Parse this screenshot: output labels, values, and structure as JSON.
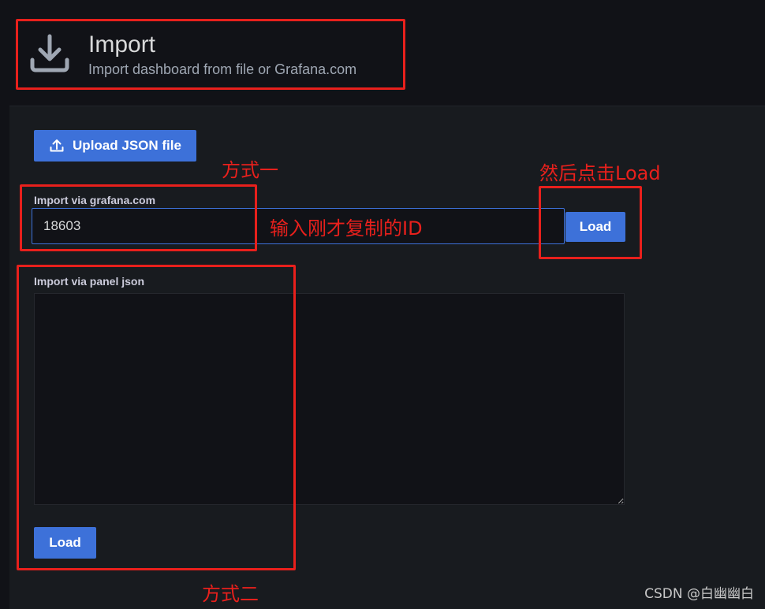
{
  "header": {
    "icon": "download-icon",
    "title": "Import",
    "subtitle": "Import dashboard from file or Grafana.com"
  },
  "upload": {
    "icon": "upload-icon",
    "label": "Upload JSON file"
  },
  "grafana_import": {
    "label": "Import via grafana.com",
    "value": "18603",
    "load_label": "Load"
  },
  "panel_import": {
    "label": "Import via panel json",
    "value": "",
    "load_label": "Load"
  },
  "annotations": {
    "method_one": "方式一",
    "then_click_load": "然后点击Load",
    "input_copied_id": "输入刚才复制的ID",
    "method_two": "方式二"
  },
  "watermark": "CSDN @白幽幽白",
  "colors": {
    "background": "#111217",
    "panel": "#181b1f",
    "primary_button": "#3d71d9",
    "annotation_red": "#e8201c"
  }
}
